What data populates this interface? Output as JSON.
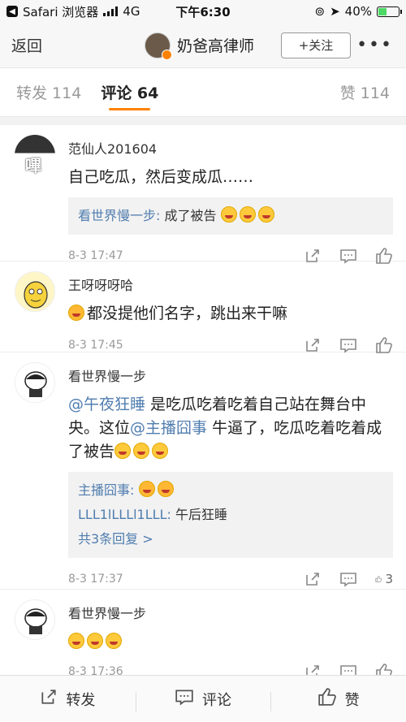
{
  "status_bar": {
    "carrier": "Safari 浏览器",
    "network": "4G",
    "time": "下午6:30",
    "battery": "40%",
    "battery_level": 0.4
  },
  "nav": {
    "back_label": "返回",
    "title": "奶爸高律师",
    "follow_label": "+关注",
    "more_label": "•••"
  },
  "tabs": {
    "repost": "转发 114",
    "comments": "评论 64",
    "likes": "赞 114"
  },
  "comments": [
    {
      "author": "范仙人201604",
      "avatar_text": "嗶",
      "text": "自己吃瓜，然后变成瓜……",
      "reply_author": "看世界慢一步:",
      "reply_text": "成了被告",
      "time": "8-3 17:47"
    },
    {
      "author": "王呀呀呀哈",
      "text": "都没提他们名字，跳出来干嘛",
      "time": "8-3 17:45"
    },
    {
      "author": "看世界慢一步",
      "mention1": "@午夜狂睡",
      "text1": " 是吃瓜吃着吃着自己站在舞台中央。这位",
      "mention2": "@主播囧事",
      "text2": " 牛逼了，吃瓜吃着吃着成了被告",
      "reply1_author": "主播囧事:",
      "reply2_author": "LLL1lLLLl1LLL:",
      "reply2_text": "午后狂睡",
      "more_replies": "共3条回复 >",
      "time": "8-3 17:37",
      "like_count": "3"
    },
    {
      "author": "看世界慢一步",
      "time": "8-3 17:36"
    }
  ],
  "bottom_bar": {
    "repost": "转发",
    "comment": "评论",
    "like": "赞"
  },
  "colors": {
    "accent": "#ff8200",
    "link": "#507daf",
    "mention": "#eb7350"
  }
}
